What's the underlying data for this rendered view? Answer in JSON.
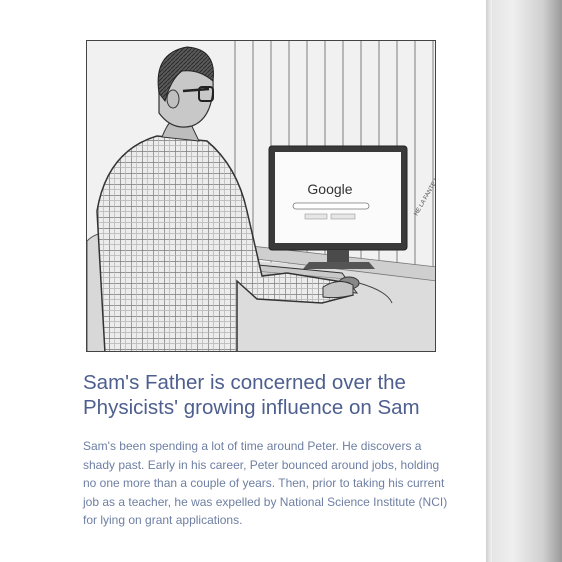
{
  "article": {
    "illustration": {
      "screen_logo": "Google",
      "signature": "HE LA FANTE MACDO"
    },
    "title": "Sam's Father is concerned over the Physicists' growing influence on Sam",
    "body": "Sam's been spending a lot of time around Peter.  He discovers a shady past.  Early in his career, Peter bounced around jobs, holding no one more than a couple of years. Then, prior to taking his current job as a teacher, he was expelled by National Science Institute (NCI) for lying on grant applications."
  },
  "colors": {
    "title": "#4e5f8f",
    "body": "#6e7fa3"
  }
}
